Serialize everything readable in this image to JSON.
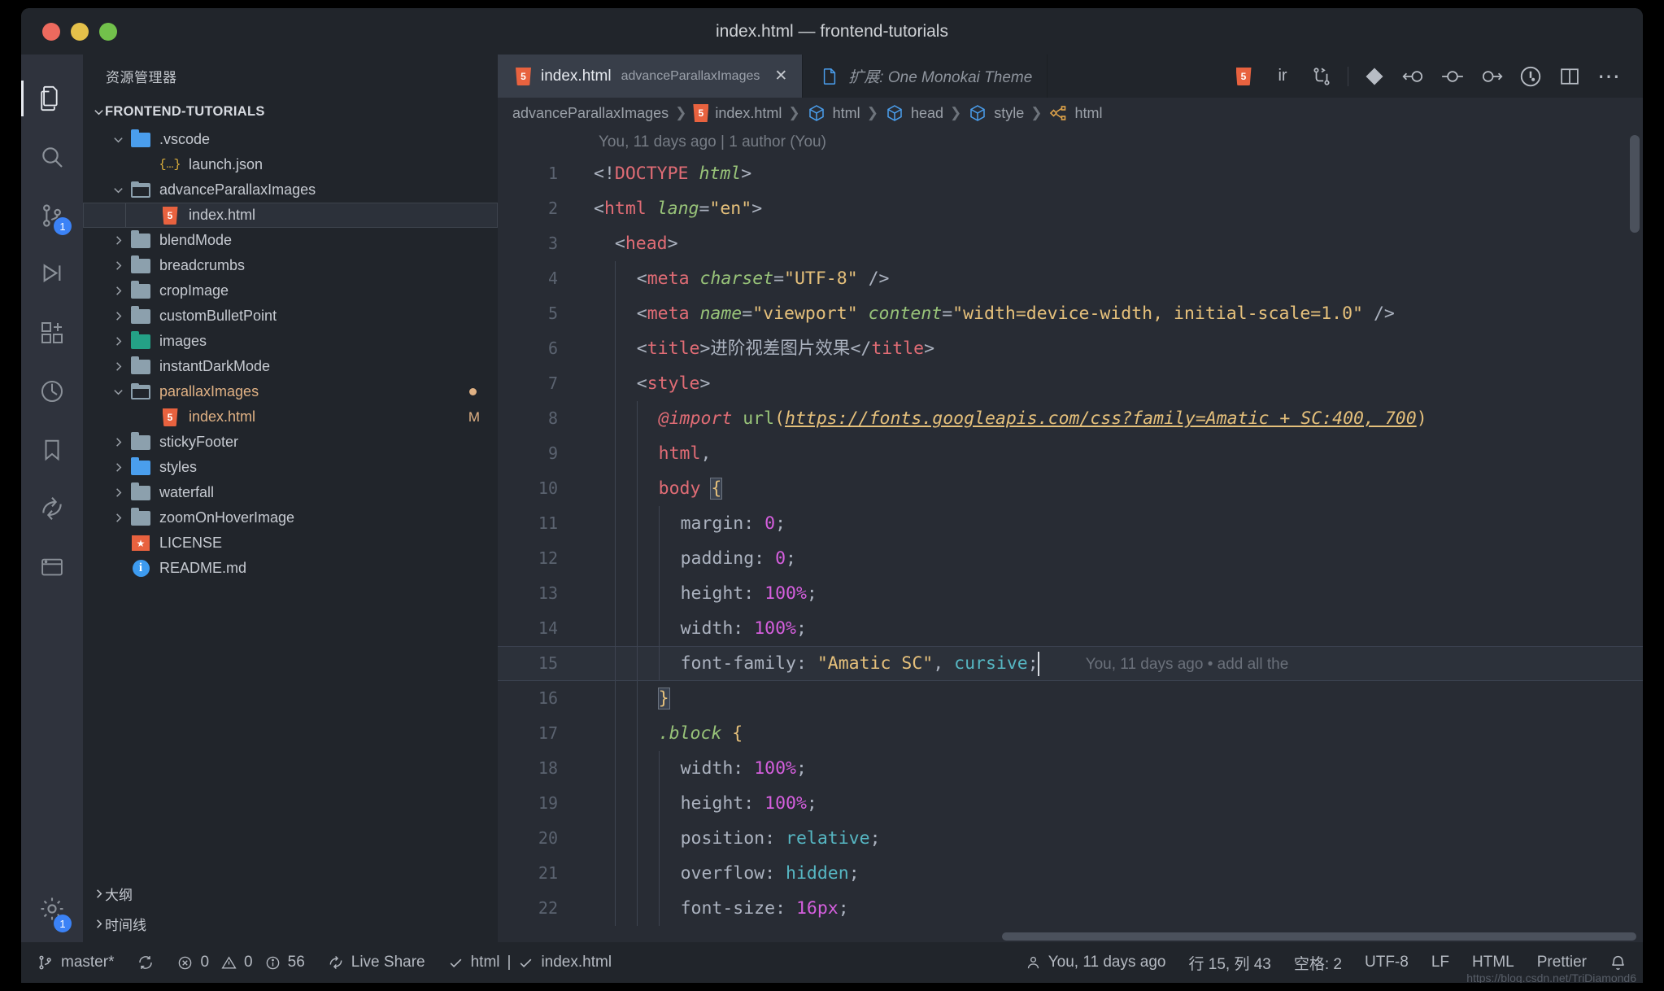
{
  "window": {
    "title": "index.html — frontend-tutorials",
    "traffic_lights": [
      "close-red",
      "minimize-yellow",
      "maximize-green"
    ]
  },
  "activity_bar": {
    "items": [
      {
        "name": "explorer",
        "icon": "files-icon",
        "active": true,
        "badge": ""
      },
      {
        "name": "search",
        "icon": "search-icon",
        "active": false,
        "badge": ""
      },
      {
        "name": "source-control",
        "icon": "source-control-icon",
        "active": false,
        "badge": "1"
      },
      {
        "name": "run-and-debug",
        "icon": "debug-icon",
        "active": false,
        "badge": ""
      },
      {
        "name": "extensions",
        "icon": "extensions-icon",
        "active": false,
        "badge": ""
      },
      {
        "name": "testing",
        "icon": "beaker-icon",
        "active": false,
        "badge": ""
      },
      {
        "name": "bookmarks",
        "icon": "bookmark-icon",
        "active": false,
        "badge": ""
      },
      {
        "name": "live-share",
        "icon": "live-share-icon",
        "active": false,
        "badge": ""
      },
      {
        "name": "remote-explorer",
        "icon": "remote-icon",
        "active": false,
        "badge": ""
      }
    ],
    "bottom": [
      {
        "name": "manage",
        "icon": "gear-icon",
        "badge": "1"
      }
    ]
  },
  "sidebar": {
    "header": "资源管理器",
    "section_title": "FRONTEND-TUTORIALS",
    "tree": [
      {
        "label": ".vscode",
        "icon": "folder-vscode-icon",
        "depth": 1,
        "expanded": true,
        "arrow": "down",
        "selected": false,
        "modified": false,
        "badge": ""
      },
      {
        "label": "launch.json",
        "icon": "json-icon",
        "depth": 2,
        "expanded": null,
        "arrow": "none",
        "selected": false,
        "modified": false,
        "badge": ""
      },
      {
        "label": "advanceParallaxImages",
        "icon": "folder-open-icon",
        "depth": 1,
        "expanded": true,
        "arrow": "down",
        "selected": false,
        "modified": false,
        "badge": ""
      },
      {
        "label": "index.html",
        "icon": "html5-icon",
        "depth": 2,
        "expanded": null,
        "arrow": "none",
        "selected": true,
        "modified": false,
        "badge": ""
      },
      {
        "label": "blendMode",
        "icon": "folder-icon",
        "depth": 1,
        "expanded": false,
        "arrow": "right",
        "selected": false,
        "modified": false,
        "badge": ""
      },
      {
        "label": "breadcrumbs",
        "icon": "folder-icon",
        "depth": 1,
        "expanded": false,
        "arrow": "right",
        "selected": false,
        "modified": false,
        "badge": ""
      },
      {
        "label": "cropImage",
        "icon": "folder-icon",
        "depth": 1,
        "expanded": false,
        "arrow": "right",
        "selected": false,
        "modified": false,
        "badge": ""
      },
      {
        "label": "customBulletPoint",
        "icon": "folder-icon",
        "depth": 1,
        "expanded": false,
        "arrow": "right",
        "selected": false,
        "modified": false,
        "badge": ""
      },
      {
        "label": "images",
        "icon": "folder-images-icon",
        "depth": 1,
        "expanded": false,
        "arrow": "right",
        "selected": false,
        "modified": false,
        "badge": ""
      },
      {
        "label": "instantDarkMode",
        "icon": "folder-icon",
        "depth": 1,
        "expanded": false,
        "arrow": "right",
        "selected": false,
        "modified": false,
        "badge": ""
      },
      {
        "label": "parallaxImages",
        "icon": "folder-open-icon",
        "depth": 1,
        "expanded": true,
        "arrow": "down",
        "selected": false,
        "modified": true,
        "badge": "dot"
      },
      {
        "label": "index.html",
        "icon": "html5-icon",
        "depth": 2,
        "expanded": null,
        "arrow": "none",
        "selected": false,
        "modified": true,
        "badge": "M"
      },
      {
        "label": "stickyFooter",
        "icon": "folder-icon",
        "depth": 1,
        "expanded": false,
        "arrow": "right",
        "selected": false,
        "modified": false,
        "badge": ""
      },
      {
        "label": "styles",
        "icon": "folder-styles-icon",
        "depth": 1,
        "expanded": false,
        "arrow": "right",
        "selected": false,
        "modified": false,
        "badge": ""
      },
      {
        "label": "waterfall",
        "icon": "folder-icon",
        "depth": 1,
        "expanded": false,
        "arrow": "right",
        "selected": false,
        "modified": false,
        "badge": ""
      },
      {
        "label": "zoomOnHoverImage",
        "icon": "folder-icon",
        "depth": 1,
        "expanded": false,
        "arrow": "right",
        "selected": false,
        "modified": false,
        "badge": ""
      },
      {
        "label": "LICENSE",
        "icon": "license-icon",
        "depth": 1,
        "expanded": null,
        "arrow": "none",
        "selected": false,
        "modified": false,
        "badge": ""
      },
      {
        "label": "README.md",
        "icon": "info-icon",
        "depth": 1,
        "expanded": null,
        "arrow": "none",
        "selected": false,
        "modified": false,
        "badge": ""
      }
    ],
    "footer": [
      {
        "label": "大纲",
        "arrow": "right"
      },
      {
        "label": "时间线",
        "arrow": "right"
      }
    ]
  },
  "tabs": [
    {
      "name": "index.html",
      "description": "advanceParallaxImages",
      "icon": "html5-icon",
      "active": true,
      "closable": true,
      "close_label": "✕"
    },
    {
      "name": "扩展: One Monokai Theme",
      "description": "",
      "icon": "file-icon",
      "active": false,
      "closable": false,
      "close_label": ""
    }
  ],
  "editor_actions": [
    {
      "name": "html-preview-icon",
      "label": ""
    },
    {
      "name": "open-preview-label",
      "label": "ir"
    },
    {
      "name": "git-compare-icon",
      "label": ""
    },
    {
      "name": "git-lens-diamond-icon",
      "label": ""
    },
    {
      "name": "go-back-commit-icon",
      "label": ""
    },
    {
      "name": "commit-node-icon",
      "label": ""
    },
    {
      "name": "go-forward-commit-icon",
      "label": ""
    },
    {
      "name": "blame-toggle-icon",
      "label": ""
    },
    {
      "name": "split-editor-icon",
      "label": ""
    },
    {
      "name": "more-actions-icon",
      "label": "⋯"
    }
  ],
  "breadcrumbs": [
    {
      "label": "advanceParallaxImages",
      "icon": ""
    },
    {
      "label": "index.html",
      "icon": "html5-icon"
    },
    {
      "label": "html",
      "icon": "symbol-cube-icon"
    },
    {
      "label": "head",
      "icon": "symbol-cube-icon"
    },
    {
      "label": "style",
      "icon": "symbol-cube-icon"
    },
    {
      "label": "html",
      "icon": "symbol-css-icon"
    }
  ],
  "editor": {
    "blame_header": "You, 11 days ago | 1 author (You)",
    "inline_blame": "You, 11 days ago • add all the",
    "highlighted_line": 15,
    "cursor_line": 15,
    "lines": [
      {
        "n": "1",
        "text": "<!DOCTYPE html>"
      },
      {
        "n": "2",
        "text": "<html lang=\"en\">"
      },
      {
        "n": "3",
        "text": "  <head>"
      },
      {
        "n": "4",
        "text": "    <meta charset=\"UTF-8\" />"
      },
      {
        "n": "5",
        "text": "    <meta name=\"viewport\" content=\"width=device-width, initial-scale=1.0\" />"
      },
      {
        "n": "6",
        "text": "    <title>进阶视差图片效果</title>"
      },
      {
        "n": "7",
        "text": "    <style>"
      },
      {
        "n": "8",
        "text": "      @import url(https://fonts.googleapis.com/css?family=Amatic + SC:400, 700)"
      },
      {
        "n": "9",
        "text": "      html,"
      },
      {
        "n": "10",
        "text": "      body {"
      },
      {
        "n": "11",
        "text": "        margin: 0;"
      },
      {
        "n": "12",
        "text": "        padding: 0;"
      },
      {
        "n": "13",
        "text": "        height: 100%;"
      },
      {
        "n": "14",
        "text": "        width: 100%;"
      },
      {
        "n": "15",
        "text": "        font-family: \"Amatic SC\", cursive;"
      },
      {
        "n": "16",
        "text": "      }"
      },
      {
        "n": "17",
        "text": "      .block {"
      },
      {
        "n": "18",
        "text": "        width: 100%;"
      },
      {
        "n": "19",
        "text": "        height: 100%;"
      },
      {
        "n": "20",
        "text": "        position: relative;"
      },
      {
        "n": "21",
        "text": "        overflow: hidden;"
      },
      {
        "n": "22",
        "text": "        font-size: 16px;"
      }
    ]
  },
  "statusbar": {
    "branch": "master*",
    "sync_icon": "sync-icon",
    "errors": "0",
    "warnings": "0",
    "infos": "56",
    "live_share": "Live Share",
    "check_html": "html | ✓ index.html",
    "html_label": "html",
    "file_label": "index.html",
    "blame": "You, 11 days ago",
    "position": "行 15, 列 43",
    "indent": "空格: 2",
    "encoding": "UTF-8",
    "eol": "LF",
    "language": "HTML",
    "formatter": "Prettier",
    "bell": "bell-icon",
    "watermark": "https://blog.csdn.net/TriDiamond6"
  }
}
